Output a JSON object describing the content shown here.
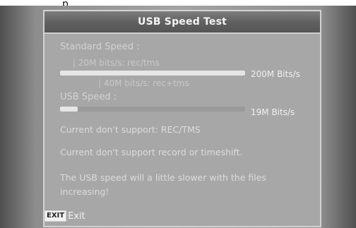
{
  "window": {
    "title": "USB Speed Test"
  },
  "standard_speed": {
    "label": "Standard Speed :",
    "note_120": "| 20M bits/s: rec/tms",
    "note_140": "| 40M bits/s: rec+tms",
    "bar_fill_fraction": 1.0,
    "value": "200M Bits/s"
  },
  "usb_speed": {
    "label": "USB Speed :",
    "bar_fill_fraction": 0.095,
    "value": "19M Bits/s"
  },
  "messages": {
    "support_rec": "Current don't support: REC/TMS",
    "support_record": "Current don't support record or timeshift.",
    "slowdown": "The USB speed will a little slower with the files increasing!"
  },
  "footer": {
    "exit_key": "EXIT",
    "exit_label": "Exit"
  },
  "colors": {
    "panel_bg": "#a7a7a7",
    "title_bg": "#5f5f5f",
    "bar_fill": "#e6e6e6",
    "bar_track": "#9a9a9a"
  }
}
